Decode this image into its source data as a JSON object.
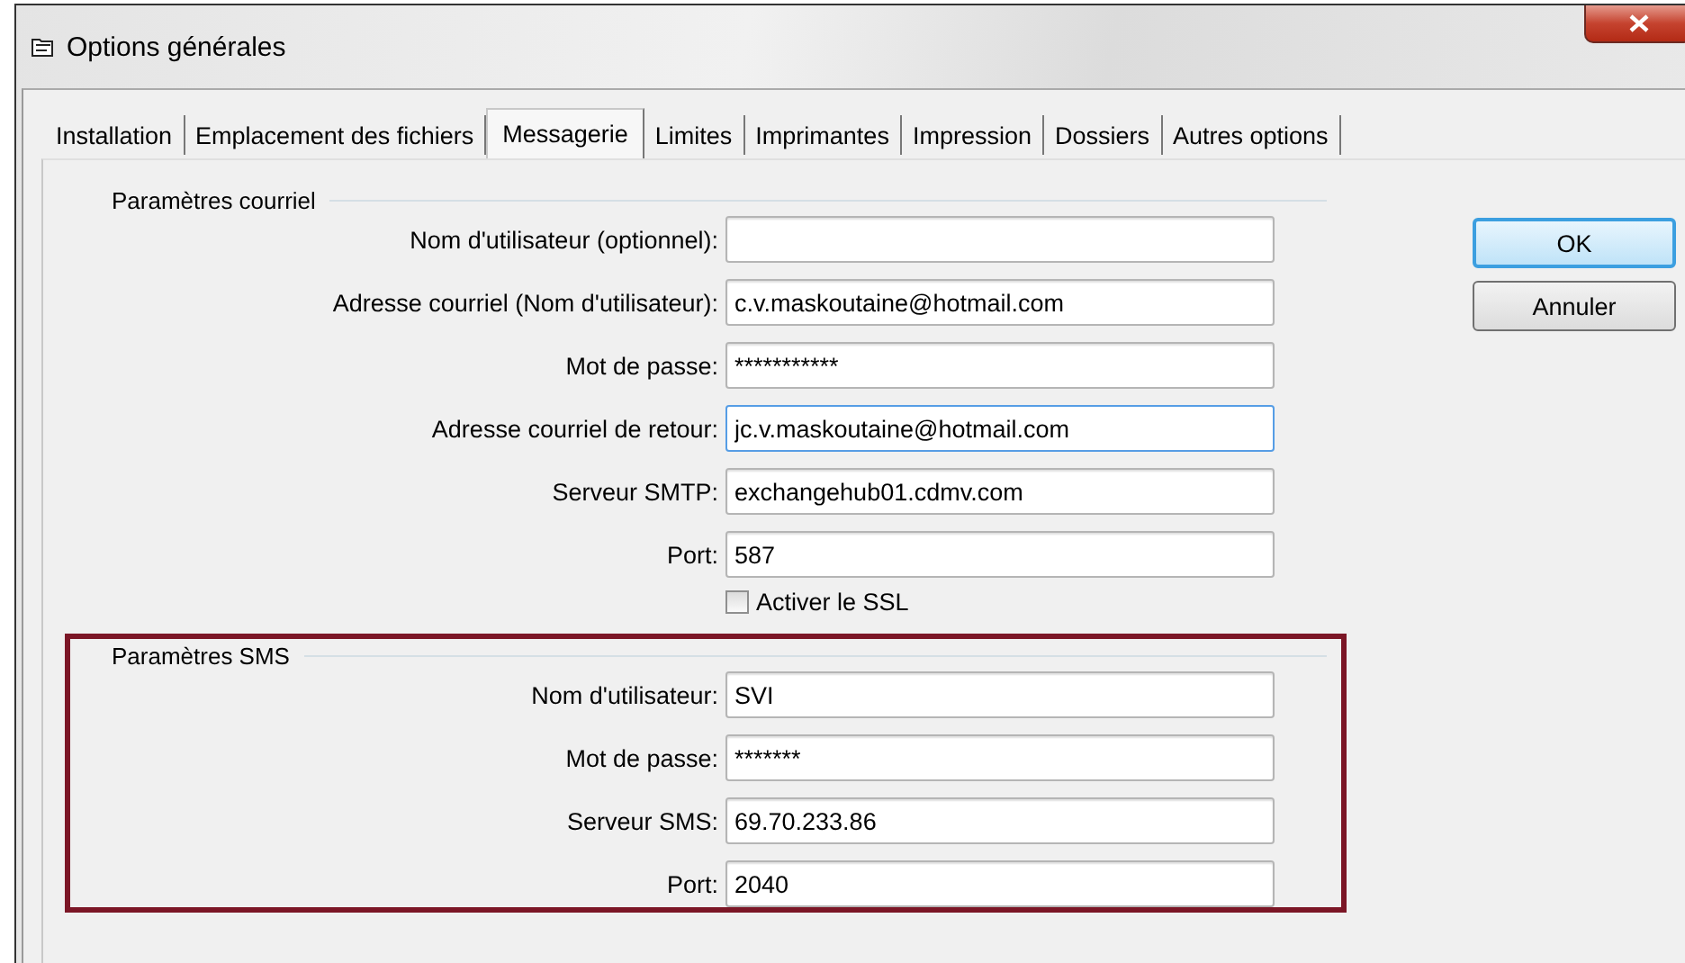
{
  "window": {
    "title": "Options générales"
  },
  "tabs": [
    {
      "label": "Installation",
      "selected": false
    },
    {
      "label": "Emplacement des fichiers",
      "selected": false
    },
    {
      "label": "Messagerie",
      "selected": true
    },
    {
      "label": "Limites",
      "selected": false
    },
    {
      "label": "Imprimantes",
      "selected": false
    },
    {
      "label": "Impression",
      "selected": false
    },
    {
      "label": "Dossiers",
      "selected": false
    },
    {
      "label": "Autres options",
      "selected": false
    }
  ],
  "email_section": {
    "title": "Paramètres courriel",
    "fields": [
      {
        "label": "Nom d'utilisateur (optionnel):",
        "focused": false
      },
      {
        "label": "Adresse courriel (Nom d'utilisateur):",
        "value": "c.v.maskoutaine@hotmail.com",
        "focused": false
      },
      {
        "label": "Mot de passe:",
        "value": "***********",
        "focused": false
      },
      {
        "label": "Adresse courriel de retour:",
        "value": "jc.v.maskoutaine@hotmail.com",
        "focused": true
      },
      {
        "label": "Serveur SMTP:",
        "value": "exchangehub01.cdmv.com",
        "focused": false
      },
      {
        "label": "Port:",
        "value": "587",
        "focused": false
      }
    ],
    "ssl": {
      "label": "Activer le SSL",
      "checked": false
    }
  },
  "sms_section": {
    "title": "Paramètres SMS",
    "highlighted": true,
    "fields": [
      {
        "label": "Nom d'utilisateur:",
        "value": "SVI",
        "focused": false
      },
      {
        "label": "Mot de passe:",
        "value": "*******",
        "focused": false
      },
      {
        "label": "Serveur SMS:",
        "value": "69.70.233.86",
        "focused": false
      },
      {
        "label": "Port:",
        "value": "2040",
        "focused": false
      }
    ]
  },
  "buttons": [
    {
      "label": "OK",
      "default": true
    },
    {
      "label": "Annuler",
      "default": false
    }
  ]
}
